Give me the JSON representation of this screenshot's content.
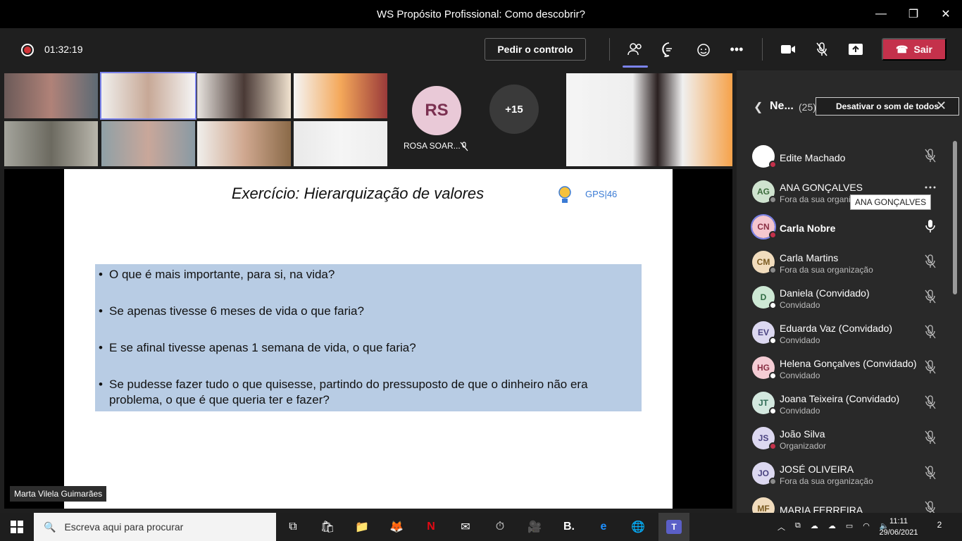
{
  "window": {
    "title": "WS Propósito Profissional: Como descobrir?",
    "minimize_icon": "minimize-icon",
    "maximize_icon": "maximize-icon",
    "close_icon": "close-icon"
  },
  "toolbar": {
    "timer": "01:32:19",
    "request_control": "Pedir o controlo",
    "leave": "Sair",
    "icons": [
      "participants-icon",
      "chat-icon",
      "reactions-icon",
      "more-icon",
      "camera-icon",
      "mic-off-icon",
      "share-icon"
    ]
  },
  "stage": {
    "rs_initials": "RS",
    "rs_name": "ROSA SOAR...",
    "more_participants": "+15",
    "slide_title": "Exercício: Hierarquização de valores",
    "slide_logo": "GPS|46",
    "questions": [
      "O que é mais importante, para si, na vida?",
      "Se apenas tivesse 6 meses de vida o que faria?",
      "E se afinal tivesse apenas 1 semana de vida, o que faria?",
      "Se pudesse fazer tudo o que quisesse, partindo do pressuposto de que o dinheiro não era problema, o que é que queria ter e fazer?"
    ],
    "presenter_name": "Marta Vilela Guimarães"
  },
  "panel": {
    "title": "Ne...",
    "count": "(25)",
    "mute_all": "Desativar o som de todos",
    "tooltip": "ANA GONÇALVES",
    "participants": [
      {
        "initials": "",
        "name": "Edite Machado",
        "sub": "",
        "avatar_bg": "#ffffff",
        "avatar_fg": "#333333",
        "status": "#c4314b",
        "mic": "off",
        "bold": false
      },
      {
        "initials": "AG",
        "name": "ANA GONÇALVES",
        "sub": "Fora da sua organiz...",
        "avatar_bg": "#cfe3cf",
        "avatar_fg": "#3b6b3b",
        "status": "#8a8a8a",
        "mic": "more",
        "bold": false
      },
      {
        "initials": "CN",
        "name": "Carla Nobre",
        "sub": "",
        "avatar_bg": "#f4c6cf",
        "avatar_fg": "#8a3044",
        "status": "#c4314b",
        "mic": "on",
        "bold": true
      },
      {
        "initials": "CM",
        "name": "Carla Martins",
        "sub": "Fora da sua organização",
        "avatar_bg": "#f1dcbd",
        "avatar_fg": "#7a5a20",
        "status": "#8a8a8a",
        "mic": "off",
        "bold": false
      },
      {
        "initials": "D",
        "name": "Daniela (Convidado)",
        "sub": "Convidado",
        "avatar_bg": "#cde8d4",
        "avatar_fg": "#2f6b43",
        "status": "#ffffff",
        "mic": "off",
        "bold": false
      },
      {
        "initials": "EV",
        "name": "Eduarda Vaz (Convidado)",
        "sub": "Convidado",
        "avatar_bg": "#dcd8f0",
        "avatar_fg": "#4a4380",
        "status": "#ffffff",
        "mic": "off",
        "bold": false
      },
      {
        "initials": "HG",
        "name": "Helena Gonçalves (Convidado)",
        "sub": "Convidado",
        "avatar_bg": "#f4ccd4",
        "avatar_fg": "#8a3044",
        "status": "#ffffff",
        "mic": "off",
        "bold": false
      },
      {
        "initials": "JT",
        "name": "Joana Teixeira (Convidado)",
        "sub": "Convidado",
        "avatar_bg": "#d3e8df",
        "avatar_fg": "#2f6b55",
        "status": "#ffffff",
        "mic": "off",
        "bold": false
      },
      {
        "initials": "JS",
        "name": "João Silva",
        "sub": "Organizador",
        "avatar_bg": "#dcd8f0",
        "avatar_fg": "#4a4380",
        "status": "#c4314b",
        "mic": "off",
        "bold": false
      },
      {
        "initials": "JO",
        "name": "JOSÉ OLIVEIRA",
        "sub": "Fora da sua organização",
        "avatar_bg": "#dcd8f0",
        "avatar_fg": "#4a4380",
        "status": "#8a8a8a",
        "mic": "off",
        "bold": false
      },
      {
        "initials": "MF",
        "name": "MARIA FERREIRA",
        "sub": "",
        "avatar_bg": "#f1dcbd",
        "avatar_fg": "#7a5a20",
        "status": "#8a8a8a",
        "mic": "off",
        "bold": false
      }
    ]
  },
  "taskbar": {
    "search_placeholder": "Escreva aqui para procurar",
    "time": "11:11",
    "date": "29/06/2021",
    "notifications": "2"
  }
}
